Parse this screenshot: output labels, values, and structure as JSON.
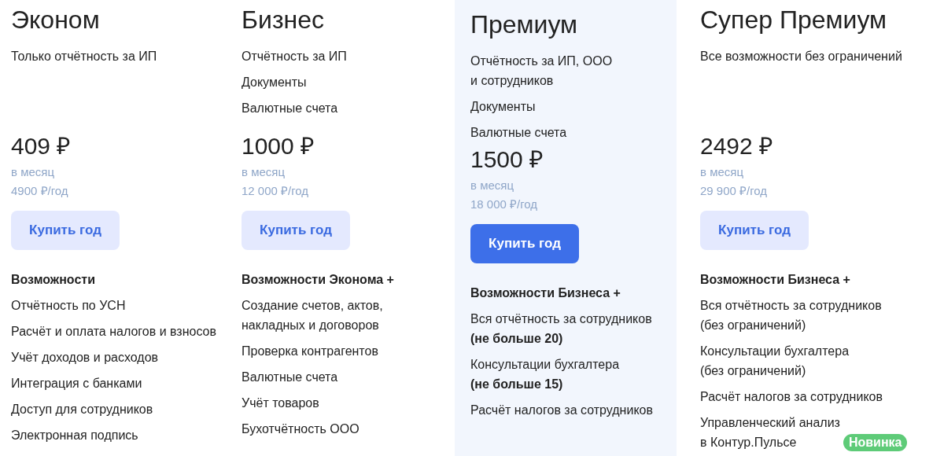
{
  "plans": [
    {
      "name": "Эконом",
      "featured": false,
      "description": [
        {
          "lines": [
            "Только отчётность за ИП"
          ]
        }
      ],
      "price": "409 ₽",
      "period": "в месяц",
      "yearly": "4900 ₽/год",
      "button": "Купить год",
      "features_title": "Возможности",
      "features": [
        {
          "lines": [
            "Отчётность по УСН"
          ]
        },
        {
          "lines": [
            "Расчёт и оплата налогов и взносов"
          ]
        },
        {
          "lines": [
            "Учёт доходов и расходов"
          ]
        },
        {
          "lines": [
            "Интеграция с банками"
          ]
        },
        {
          "lines": [
            "Доступ для сотрудников"
          ]
        },
        {
          "lines": [
            "Электронная подпись"
          ]
        }
      ]
    },
    {
      "name": "Бизнес",
      "featured": false,
      "description": [
        {
          "lines": [
            "Отчётность за ИП"
          ]
        },
        {
          "lines": [
            "Документы"
          ]
        },
        {
          "lines": [
            "Валютные счета"
          ]
        }
      ],
      "price": "1000 ₽",
      "period": "в месяц",
      "yearly": "12 000 ₽/год",
      "button": "Купить год",
      "features_title": "Возможности Эконома +",
      "features": [
        {
          "lines": [
            "Создание счетов, актов,",
            "накладных и договоров"
          ]
        },
        {
          "lines": [
            "Проверка контрагентов"
          ]
        },
        {
          "lines": [
            "Валютные счета"
          ]
        },
        {
          "lines": [
            "Учёт товаров"
          ]
        },
        {
          "lines": [
            "Бухотчётность ООО"
          ]
        }
      ]
    },
    {
      "name": "Премиум",
      "featured": true,
      "description": [
        {
          "lines": [
            "Отчётность за ИП, ООО",
            "и сотрудников"
          ]
        },
        {
          "lines": [
            "Документы"
          ]
        },
        {
          "lines": [
            "Валютные счета"
          ]
        }
      ],
      "price": "1500 ₽",
      "period": "в месяц",
      "yearly": "18 000 ₽/год",
      "button": "Купить год",
      "features_title": "Возможности Бизнеса +",
      "features": [
        {
          "lines": [
            "Вся отчётность за сотрудников",
            "**(не больше 20)**"
          ]
        },
        {
          "lines": [
            "Консультации бухгалтера",
            "**(не больше 15)**"
          ]
        },
        {
          "lines": [
            "Расчёт налогов за сотрудников"
          ]
        }
      ]
    },
    {
      "name": "Супер Премиум",
      "featured": false,
      "description": [
        {
          "lines": [
            "Все возможности без ограничений"
          ]
        }
      ],
      "price": "2492 ₽",
      "period": "в месяц",
      "yearly": "29 900 ₽/год",
      "button": "Купить год",
      "features_title": "Возможности Бизнеса +",
      "features": [
        {
          "lines": [
            "Вся отчётность за сотрудников",
            "(без ограничений)"
          ]
        },
        {
          "lines": [
            "Консультации бухгалтера",
            "(без ограничений)"
          ]
        },
        {
          "lines": [
            "Расчёт налогов за сотрудников"
          ]
        },
        {
          "lines": [
            "Управленческий анализ",
            "в Контур.Пульсе"
          ],
          "badge": "Новинка"
        }
      ]
    }
  ]
}
